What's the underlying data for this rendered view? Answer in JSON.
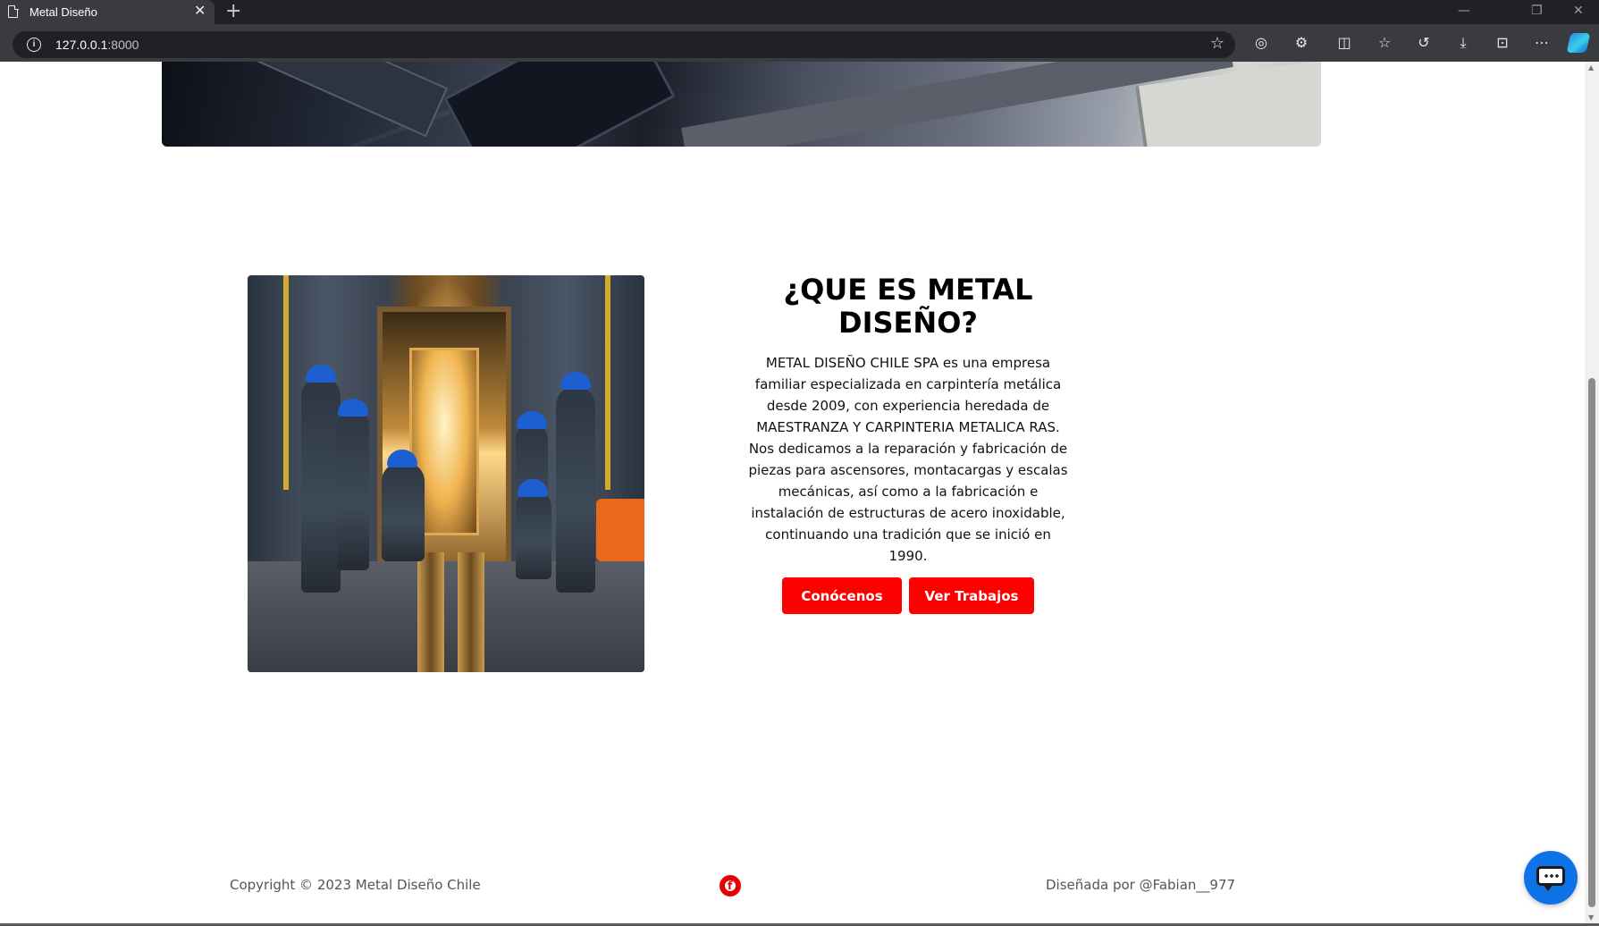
{
  "browser": {
    "tab_title": "Metal Diseño",
    "tab_close": "✕",
    "new_tab": "+",
    "url_host": "127.0.0.1",
    "url_port": ":8000",
    "window_controls": {
      "minimize": "—",
      "restore": "❐",
      "close": "✕"
    }
  },
  "about": {
    "title": "¿QUE ES METAL DISEÑO?",
    "description": "METAL DISEÑO CHILE SPA es una empresa familiar especializada en carpintería metálica desde 2009, con experiencia heredada de MAESTRANZA Y CARPINTERIA METALICA RAS. Nos dedicamos a la reparación y fabricación de piezas para ascensores, montacargas y escalas mecánicas, así como a la fabricación e instalación de estructuras de acero inoxidable, continuando una tradición que se inició en 1990.",
    "button_primary": "Conócenos",
    "button_secondary": "Ver Trabajos"
  },
  "footer": {
    "copyright": "Copyright © 2023 Metal Diseño Chile",
    "credit": "Diseñada por @Fabian__977",
    "social_icon": "facebook-icon"
  },
  "colors": {
    "accent_red": "#ff0000",
    "chat_blue": "#0f73e8"
  }
}
